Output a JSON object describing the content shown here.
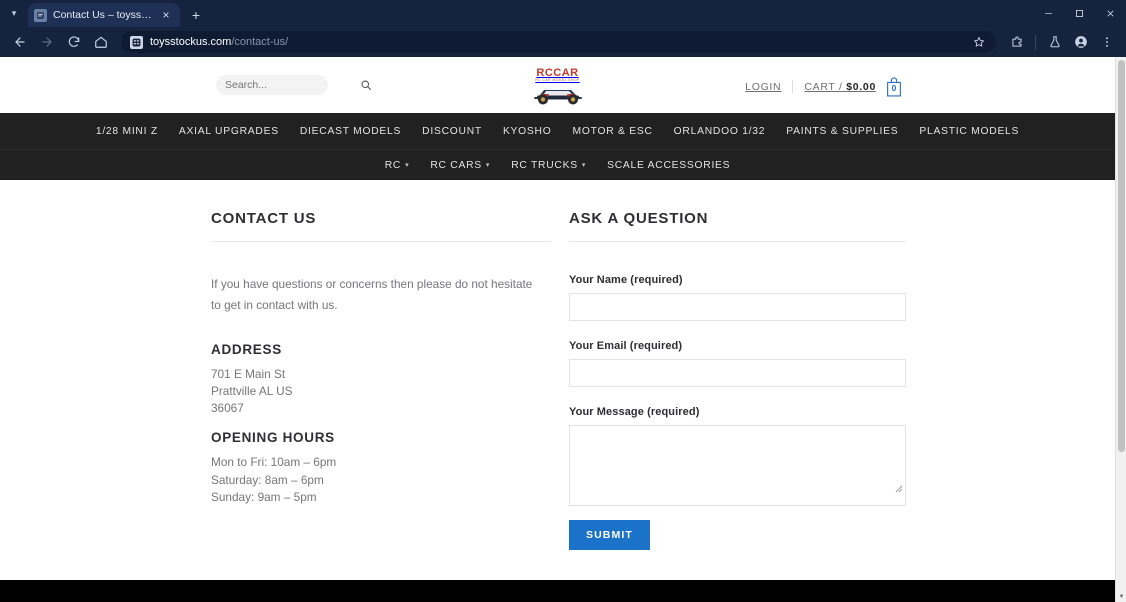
{
  "browser": {
    "tab": {
      "title": "Contact Us – toysstockus.com",
      "favicon": "page-favicon",
      "close": "×"
    },
    "new_tab": "+",
    "window": {
      "minimize": "—",
      "maximize": "◻",
      "close": "✕"
    },
    "toolbar": {
      "back": "back-arrow",
      "forward": "forward-arrow",
      "reload": "reload-icon",
      "home": "home-icon",
      "url_domain": "toysstockus.com",
      "url_path": "/contact-us/",
      "bookmark": "star-icon",
      "extensions": "extensions-icon",
      "lab": "flask-icon",
      "profile": "profile-avatar",
      "menu": "three-dot-menu"
    }
  },
  "site": {
    "search": {
      "placeholder": "Search...",
      "value": ""
    },
    "logo": {
      "word": "RCCAR",
      "tagline": "RC CAR MODEL SHOP"
    },
    "account": {
      "login": "LOGIN",
      "cart_label": "CART /",
      "cart_total": "$0.00",
      "cart_count": "0"
    },
    "nav_main": [
      {
        "label": "1/28 MINI Z"
      },
      {
        "label": "AXIAL UPGRADES"
      },
      {
        "label": "DIECAST MODELS"
      },
      {
        "label": "DISCOUNT"
      },
      {
        "label": "KYOSHO"
      },
      {
        "label": "MOTOR & ESC"
      },
      {
        "label": "ORLANDOO 1/32"
      },
      {
        "label": "PAINTS & SUPPLIES"
      },
      {
        "label": "PLASTIC MODELS"
      }
    ],
    "nav_sub": [
      {
        "label": "RC",
        "caret": "▾"
      },
      {
        "label": "RC CARS",
        "caret": "▾"
      },
      {
        "label": "RC TRUCKS",
        "caret": "▾"
      },
      {
        "label": "SCALE ACCESSORIES",
        "caret": ""
      }
    ]
  },
  "main": {
    "left": {
      "heading": "CONTACT US",
      "lead": "If you have questions or concerns then please do not hesitate to get in contact with us.",
      "address_heading": "ADDRESS",
      "address": [
        "701 E Main St",
        "Prattville AL US",
        "36067"
      ],
      "hours_heading": "OPENING HOURS",
      "hours": [
        "Mon to Fri: 10am – 6pm",
        "Saturday: 8am – 6pm",
        "Sunday: 9am – 5pm"
      ]
    },
    "right": {
      "heading": "ASK A QUESTION",
      "fields": [
        {
          "label": "Your Name (required)",
          "value": "",
          "type": "text"
        },
        {
          "label": "Your Email (required)",
          "value": "",
          "type": "text"
        },
        {
          "label": "Your Message (required)",
          "value": "",
          "type": "textarea"
        }
      ],
      "submit": "SUBMIT"
    }
  },
  "colors": {
    "accent_blue": "#1b72c9",
    "nav_dark": "#212121",
    "chrome_dark": "#15233f",
    "logo_red": "#c0392b",
    "footer_black": "#000000"
  }
}
